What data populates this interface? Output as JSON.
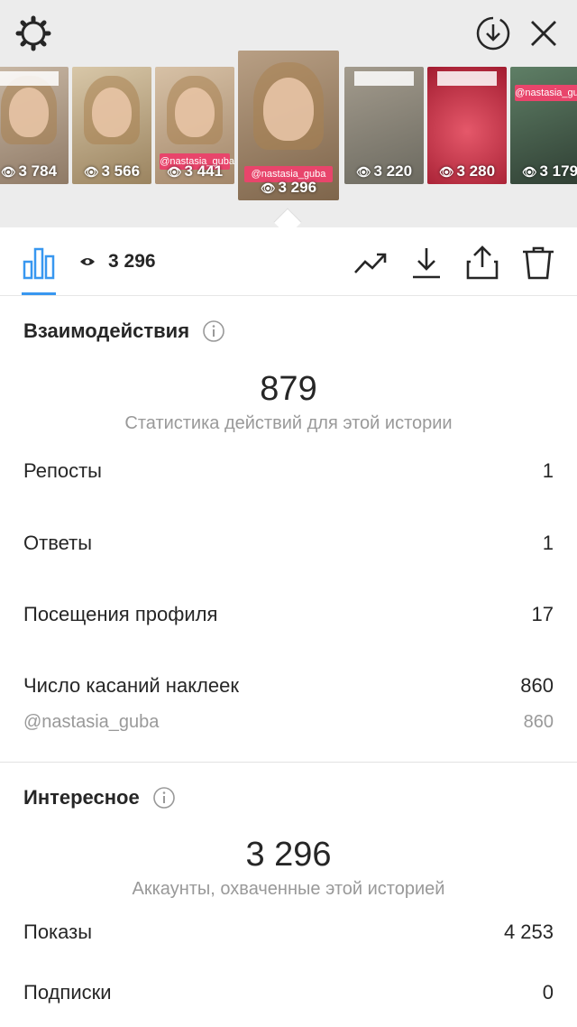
{
  "story_thumbnails": [
    {
      "views": "3 784"
    },
    {
      "views": "3 566"
    },
    {
      "views": "3 441",
      "tag": "@nastasia_guba"
    },
    {
      "views": "3 296",
      "tag": "@nastasia_guba",
      "active": true
    },
    {
      "views": "3 220"
    },
    {
      "views": "3 280"
    },
    {
      "views": "3 179",
      "tag": "@nastasia_guba"
    }
  ],
  "toolbar": {
    "views": "3 296"
  },
  "interactions": {
    "title": "Взаимодействия",
    "total": "879",
    "subtitle": "Статистика действий для этой истории",
    "rows": [
      {
        "label": "Репосты",
        "value": "1"
      },
      {
        "label": "Ответы",
        "value": "1"
      },
      {
        "label": "Посещения профиля",
        "value": "17"
      },
      {
        "label": "Число касаний наклеек",
        "value": "860"
      }
    ],
    "sticker_detail": {
      "label": "@nastasia_guba",
      "value": "860"
    }
  },
  "discovery": {
    "title": "Интересное",
    "total": "3 296",
    "subtitle": "Аккаунты, охваченные этой историей",
    "rows": [
      {
        "label": "Показы",
        "value": "4 253"
      },
      {
        "label": "Подписки",
        "value": "0"
      }
    ]
  },
  "colors": {
    "accent": "#3897f0",
    "text": "#262626",
    "muted": "#999999",
    "tag": "#e8456b"
  }
}
